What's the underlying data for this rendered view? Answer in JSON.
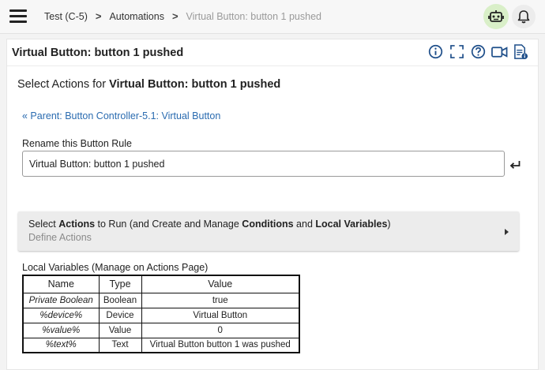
{
  "breadcrumb": {
    "items": [
      "Test (C-5)",
      "Automations",
      "Virtual Button: button 1 pushed"
    ],
    "separator": ">"
  },
  "panel": {
    "title": "Virtual Button: button 1 pushed",
    "tool_icons": [
      "info-icon",
      "fullscreen-icon",
      "help-icon",
      "video-icon",
      "log-icon"
    ]
  },
  "heading": {
    "prefix": "Select Actions for ",
    "name": "Virtual Button: button 1 pushed"
  },
  "parent_link": "« Parent: Button Controller-5.1: Virtual Button",
  "rename": {
    "label": "Rename this Button Rule",
    "value": "Virtual Button: button 1 pushed"
  },
  "actions": {
    "p1": "Select ",
    "b1": "Actions",
    "p2": " to Run (and Create and Manage ",
    "b2": "Conditions",
    "p3": " and ",
    "b3": "Local Variables",
    "p4": ")",
    "subtitle": "Define Actions"
  },
  "local_variables": {
    "title": "Local Variables",
    "note": " (Manage on Actions Page)",
    "headers": [
      "Name",
      "Type",
      "Value"
    ],
    "rows": [
      [
        "Private Boolean",
        "Boolean",
        "true"
      ],
      [
        "%device%",
        "Device",
        "Virtual Button"
      ],
      [
        "%value%",
        "Value",
        "0"
      ],
      [
        "%text%",
        "Text",
        "Virtual Button button 1 was pushed"
      ]
    ]
  },
  "colors": {
    "link": "#2a6bb0",
    "icon": "#1f4f8a",
    "robot_bg": "#d9efc8"
  }
}
